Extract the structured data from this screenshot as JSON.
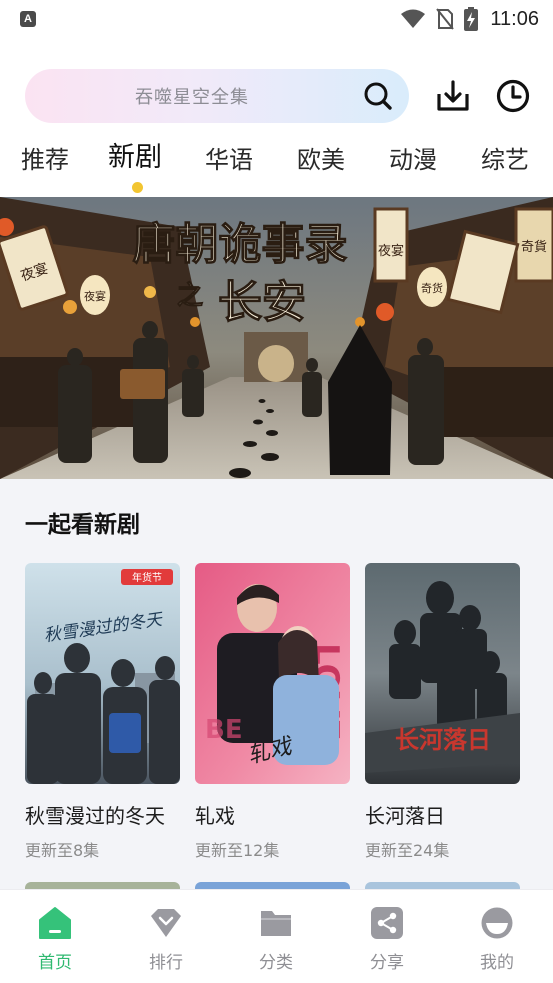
{
  "status_bar": {
    "time": "11:06",
    "app_badge": "A",
    "icons": [
      "app-notification-icon",
      "wifi-icon",
      "no-sim-icon",
      "battery-charging-icon"
    ]
  },
  "search": {
    "placeholder": "吞噬星空全集",
    "icon": "search-icon",
    "download_icon": "download-icon",
    "history_icon": "clock-icon"
  },
  "tabs": {
    "items": [
      {
        "label": "推荐"
      },
      {
        "label": "新剧"
      },
      {
        "label": "华语"
      },
      {
        "label": "欧美"
      },
      {
        "label": "动漫"
      },
      {
        "label": "综艺"
      }
    ],
    "active_index": 1,
    "indicator_color": "#f2c531"
  },
  "banner": {
    "title_line1": "唐朝诡事录",
    "title_line2_small": "之",
    "title_line2": "长安",
    "sign_left": "夜宴",
    "sign_right": "夜宴",
    "sign_far_right": "奇貨",
    "lantern_left": "夜宴",
    "lantern_right": "奇货"
  },
  "section": {
    "title": "一起看新剧",
    "cards": [
      {
        "title": "秋雪漫过的冬天",
        "subtitle": "更新至8集",
        "poster_text": "秋雪漫过的冬天",
        "poster_badge": "年货节"
      },
      {
        "title": "轧戏",
        "subtitle": "更新至12集",
        "poster_text": "轧戏"
      },
      {
        "title": "长河落日",
        "subtitle": "更新至24集",
        "poster_text": "长河落日"
      }
    ]
  },
  "bottom_nav": {
    "items": [
      {
        "label": "首页",
        "icon": "home-icon"
      },
      {
        "label": "排行",
        "icon": "ranking-icon"
      },
      {
        "label": "分类",
        "icon": "folder-icon"
      },
      {
        "label": "分享",
        "icon": "share-icon"
      },
      {
        "label": "我的",
        "icon": "profile-icon"
      }
    ],
    "active_index": 0,
    "active_color": "#2fb970",
    "inactive_color": "#8f8f94"
  }
}
